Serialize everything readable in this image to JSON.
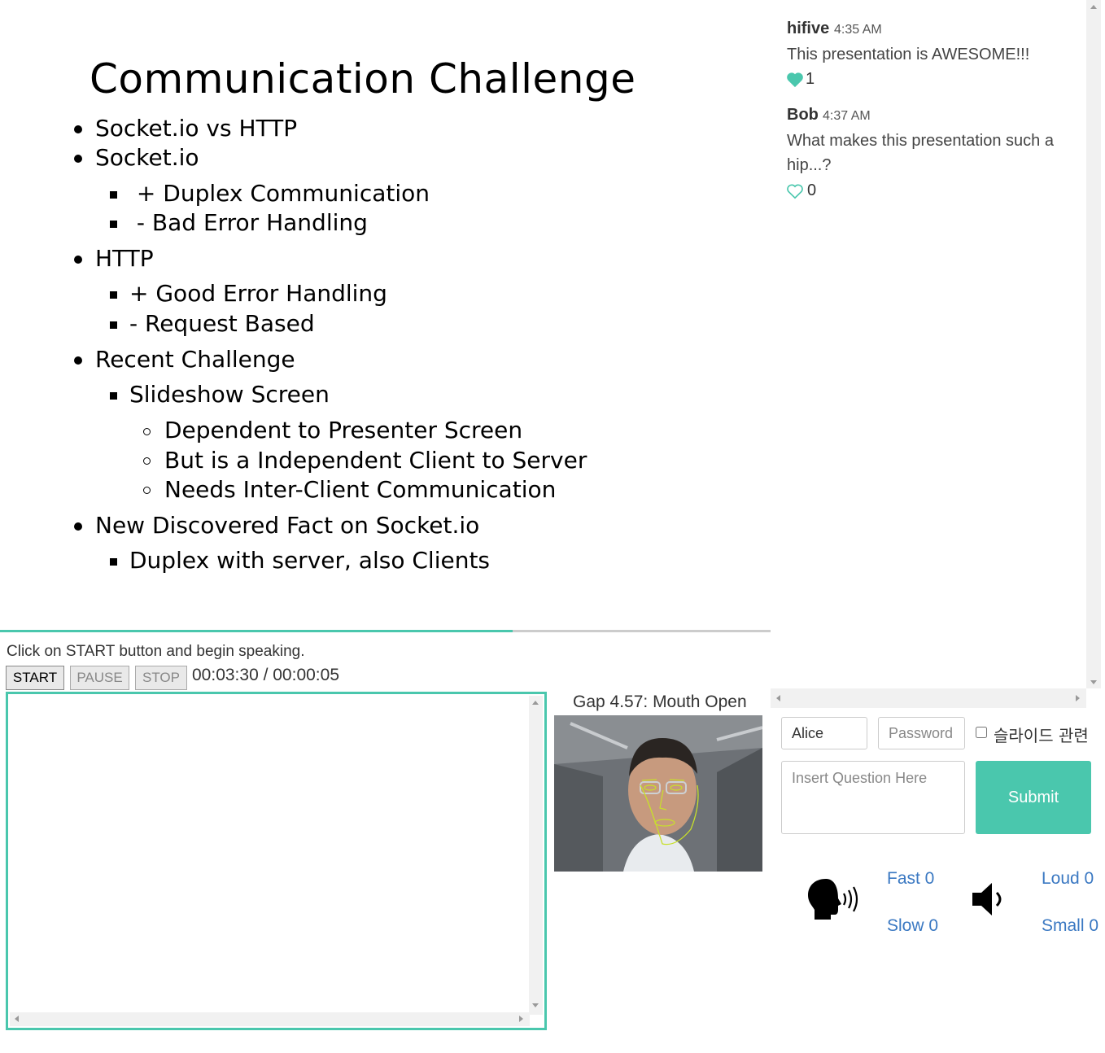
{
  "slide": {
    "title": "Communication Challenge",
    "lines": [
      "Socket.io vs HTTP",
      "Socket.io",
      " + Duplex Communication",
      " - Bad Error Handling",
      "HTTP",
      "+ Good Error Handling",
      "- Request Based",
      "Recent Challenge",
      "Slideshow Screen",
      "Dependent to Presenter Screen",
      "But is a Independent Client to Server",
      "Needs Inter-Client Communication",
      "New Discovered Fact on Socket.io",
      "Duplex with server, also Clients"
    ],
    "progress": 0.665
  },
  "chat": {
    "messages": [
      {
        "name": "hifive",
        "time": "4:35 AM",
        "text": "This presentation is AWESOME!!!",
        "likes": "1",
        "liked": true
      },
      {
        "name": "Bob",
        "time": "4:37 AM",
        "text": "What makes this presentation such a hip...?",
        "likes": "0",
        "liked": false
      }
    ]
  },
  "recorder": {
    "status": "Click on START button and begin speaking.",
    "start_label": "START",
    "pause_label": "PAUSE",
    "stop_label": "STOP",
    "timer": "00:03:30 / 00:00:05"
  },
  "camera": {
    "gap_label": "Gap 4.57: Mouth Open"
  },
  "form": {
    "name_value": "Alice",
    "password_placeholder": "Password",
    "checkbox_label": "슬라이드 관련",
    "question_placeholder": "Insert Question Here",
    "submit_label": "Submit"
  },
  "feedback": {
    "fast": "Fast 0",
    "slow": "Slow 0",
    "loud": "Loud 0",
    "small": "Small 0"
  },
  "colors": {
    "accent": "#4ac7ad",
    "link": "#3a78c2"
  },
  "icons": {
    "speaker_head": "speaking-head-icon",
    "volume": "volume-icon",
    "heart": "heart-icon"
  }
}
